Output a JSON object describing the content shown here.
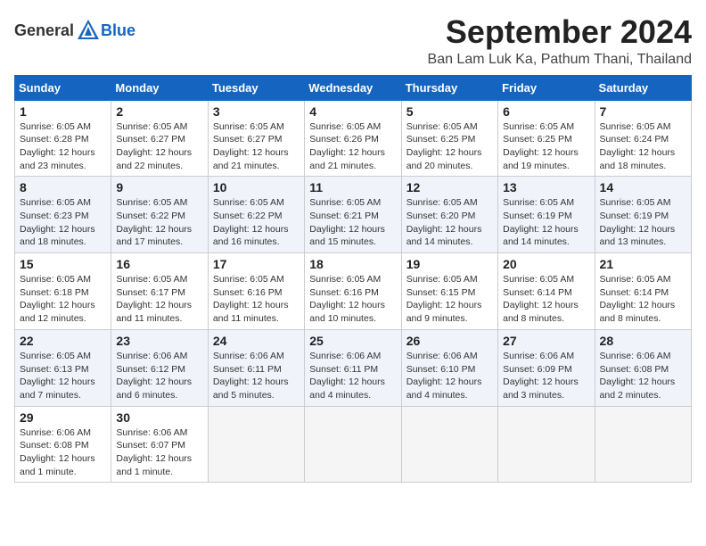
{
  "header": {
    "logo_general": "General",
    "logo_blue": "Blue",
    "month": "September 2024",
    "location": "Ban Lam Luk Ka, Pathum Thani, Thailand"
  },
  "weekdays": [
    "Sunday",
    "Monday",
    "Tuesday",
    "Wednesday",
    "Thursday",
    "Friday",
    "Saturday"
  ],
  "weeks": [
    [
      {
        "day": "1",
        "info": "Sunrise: 6:05 AM\nSunset: 6:28 PM\nDaylight: 12 hours\nand 23 minutes."
      },
      {
        "day": "2",
        "info": "Sunrise: 6:05 AM\nSunset: 6:27 PM\nDaylight: 12 hours\nand 22 minutes."
      },
      {
        "day": "3",
        "info": "Sunrise: 6:05 AM\nSunset: 6:27 PM\nDaylight: 12 hours\nand 21 minutes."
      },
      {
        "day": "4",
        "info": "Sunrise: 6:05 AM\nSunset: 6:26 PM\nDaylight: 12 hours\nand 21 minutes."
      },
      {
        "day": "5",
        "info": "Sunrise: 6:05 AM\nSunset: 6:25 PM\nDaylight: 12 hours\nand 20 minutes."
      },
      {
        "day": "6",
        "info": "Sunrise: 6:05 AM\nSunset: 6:25 PM\nDaylight: 12 hours\nand 19 minutes."
      },
      {
        "day": "7",
        "info": "Sunrise: 6:05 AM\nSunset: 6:24 PM\nDaylight: 12 hours\nand 18 minutes."
      }
    ],
    [
      {
        "day": "8",
        "info": "Sunrise: 6:05 AM\nSunset: 6:23 PM\nDaylight: 12 hours\nand 18 minutes."
      },
      {
        "day": "9",
        "info": "Sunrise: 6:05 AM\nSunset: 6:22 PM\nDaylight: 12 hours\nand 17 minutes."
      },
      {
        "day": "10",
        "info": "Sunrise: 6:05 AM\nSunset: 6:22 PM\nDaylight: 12 hours\nand 16 minutes."
      },
      {
        "day": "11",
        "info": "Sunrise: 6:05 AM\nSunset: 6:21 PM\nDaylight: 12 hours\nand 15 minutes."
      },
      {
        "day": "12",
        "info": "Sunrise: 6:05 AM\nSunset: 6:20 PM\nDaylight: 12 hours\nand 14 minutes."
      },
      {
        "day": "13",
        "info": "Sunrise: 6:05 AM\nSunset: 6:19 PM\nDaylight: 12 hours\nand 14 minutes."
      },
      {
        "day": "14",
        "info": "Sunrise: 6:05 AM\nSunset: 6:19 PM\nDaylight: 12 hours\nand 13 minutes."
      }
    ],
    [
      {
        "day": "15",
        "info": "Sunrise: 6:05 AM\nSunset: 6:18 PM\nDaylight: 12 hours\nand 12 minutes."
      },
      {
        "day": "16",
        "info": "Sunrise: 6:05 AM\nSunset: 6:17 PM\nDaylight: 12 hours\nand 11 minutes."
      },
      {
        "day": "17",
        "info": "Sunrise: 6:05 AM\nSunset: 6:16 PM\nDaylight: 12 hours\nand 11 minutes."
      },
      {
        "day": "18",
        "info": "Sunrise: 6:05 AM\nSunset: 6:16 PM\nDaylight: 12 hours\nand 10 minutes."
      },
      {
        "day": "19",
        "info": "Sunrise: 6:05 AM\nSunset: 6:15 PM\nDaylight: 12 hours\nand 9 minutes."
      },
      {
        "day": "20",
        "info": "Sunrise: 6:05 AM\nSunset: 6:14 PM\nDaylight: 12 hours\nand 8 minutes."
      },
      {
        "day": "21",
        "info": "Sunrise: 6:05 AM\nSunset: 6:14 PM\nDaylight: 12 hours\nand 8 minutes."
      }
    ],
    [
      {
        "day": "22",
        "info": "Sunrise: 6:05 AM\nSunset: 6:13 PM\nDaylight: 12 hours\nand 7 minutes."
      },
      {
        "day": "23",
        "info": "Sunrise: 6:06 AM\nSunset: 6:12 PM\nDaylight: 12 hours\nand 6 minutes."
      },
      {
        "day": "24",
        "info": "Sunrise: 6:06 AM\nSunset: 6:11 PM\nDaylight: 12 hours\nand 5 minutes."
      },
      {
        "day": "25",
        "info": "Sunrise: 6:06 AM\nSunset: 6:11 PM\nDaylight: 12 hours\nand 4 minutes."
      },
      {
        "day": "26",
        "info": "Sunrise: 6:06 AM\nSunset: 6:10 PM\nDaylight: 12 hours\nand 4 minutes."
      },
      {
        "day": "27",
        "info": "Sunrise: 6:06 AM\nSunset: 6:09 PM\nDaylight: 12 hours\nand 3 minutes."
      },
      {
        "day": "28",
        "info": "Sunrise: 6:06 AM\nSunset: 6:08 PM\nDaylight: 12 hours\nand 2 minutes."
      }
    ],
    [
      {
        "day": "29",
        "info": "Sunrise: 6:06 AM\nSunset: 6:08 PM\nDaylight: 12 hours\nand 1 minute."
      },
      {
        "day": "30",
        "info": "Sunrise: 6:06 AM\nSunset: 6:07 PM\nDaylight: 12 hours\nand 1 minute."
      },
      {
        "day": "",
        "info": ""
      },
      {
        "day": "",
        "info": ""
      },
      {
        "day": "",
        "info": ""
      },
      {
        "day": "",
        "info": ""
      },
      {
        "day": "",
        "info": ""
      }
    ]
  ]
}
